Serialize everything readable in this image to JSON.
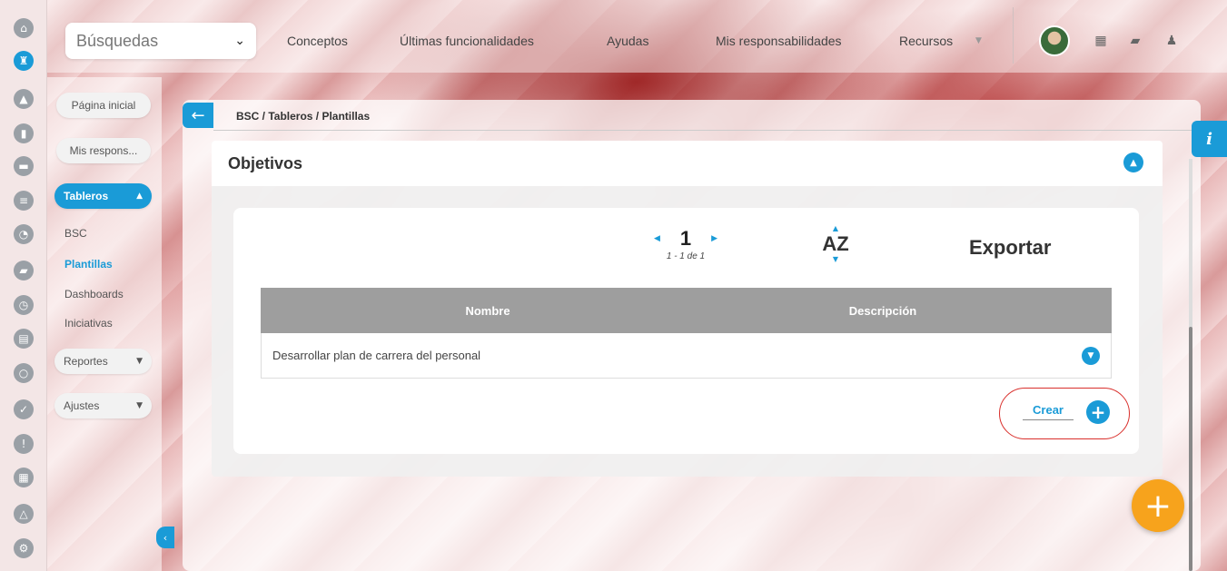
{
  "topbar": {
    "search_label": "Búsquedas",
    "nav": [
      "Conceptos",
      "Últimas funcionalidades",
      "Ayudas",
      "Mis responsabilidades",
      "Recursos"
    ]
  },
  "rail_icons": [
    "home-icon",
    "castle-icon",
    "triangle-up-icon",
    "bar-chart-icon",
    "presentation-icon",
    "menu-icon",
    "pie-chart-icon",
    "folder-icon",
    "clock-icon",
    "document-icon",
    "cycle-icon",
    "check-circle-icon",
    "alert-icon",
    "calendar-icon",
    "network-icon",
    "gear-icon"
  ],
  "sidebar": {
    "home": "Página inicial",
    "resp": "Mis respons...",
    "tableros": "Tableros",
    "sub": [
      "BSC",
      "Plantillas",
      "Dashboards",
      "Iniciativas"
    ],
    "reportes": "Reportes",
    "ajustes": "Ajustes"
  },
  "breadcrumb": "BSC / Tableros / Plantillas",
  "info_label": "i",
  "section": {
    "title": "Objetivos"
  },
  "pager": {
    "page": "1",
    "info": "1 - 1 de 1"
  },
  "sort_label": "AZ",
  "export_label": "Exportar",
  "table": {
    "headers": [
      "Nombre",
      "Descripción"
    ],
    "rows": [
      {
        "nombre": "Desarrollar plan de carrera del personal"
      }
    ]
  },
  "create_label": "Crear",
  "colors": {
    "accent": "#1a9bd7",
    "fab": "#f7a31c",
    "highlight": "#d9302c"
  }
}
